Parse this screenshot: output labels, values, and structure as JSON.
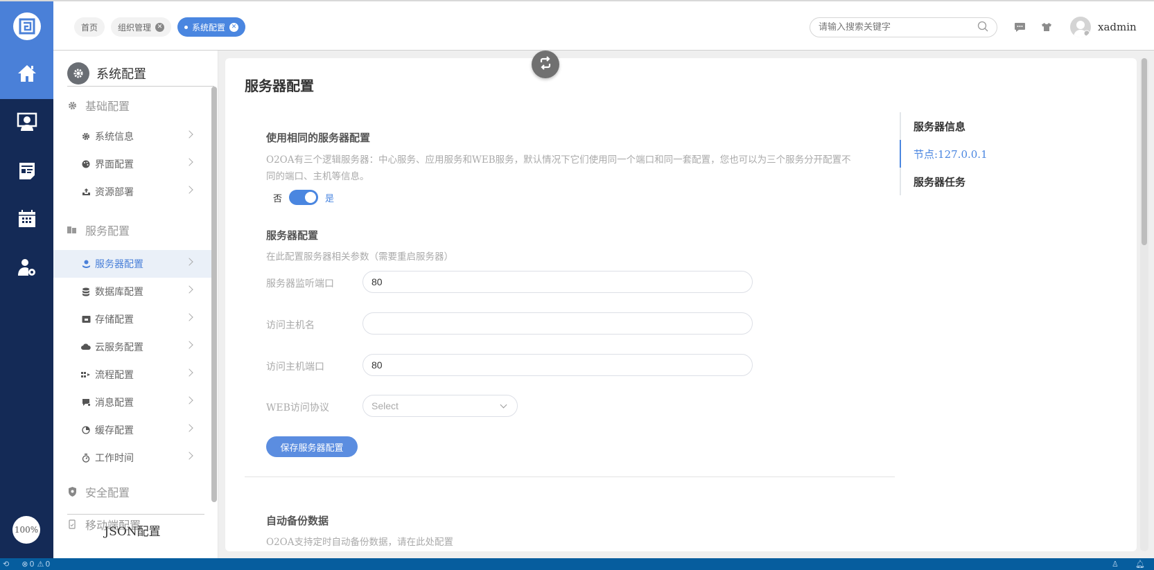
{
  "header": {
    "tabs": [
      {
        "label": "首页",
        "closable": false,
        "active": false
      },
      {
        "label": "组织管理",
        "closable": true,
        "active": false
      },
      {
        "label": "系统配置",
        "closable": true,
        "active": true
      }
    ],
    "search_placeholder": "请输入搜索关键字",
    "username": "xadmin"
  },
  "leftnav": {
    "items": [
      "home-icon",
      "desktop-user-icon",
      "news-icon",
      "calendar-icon",
      "user-settings-icon"
    ],
    "zoom": "100%"
  },
  "sidebar": {
    "title": "系统配置",
    "groups": [
      {
        "label": "基础配置",
        "items": [
          "系统信息",
          "界面配置",
          "资源部署"
        ]
      },
      {
        "label": "服务配置",
        "items": [
          "服务器配置",
          "数据库配置",
          "存储配置",
          "云服务配置",
          "流程配置",
          "消息配置",
          "缓存配置",
          "工作时间"
        ]
      },
      {
        "label": "安全配置",
        "items": []
      },
      {
        "label": "移动端配置",
        "items": []
      }
    ],
    "active_item": "服务器配置",
    "json_label": "JSON配置"
  },
  "main": {
    "title": "服务器配置",
    "same_config": {
      "title": "使用相同的服务器配置",
      "desc_line1": "O2OA有三个逻辑服务器：中心服务、应用服务和WEB服务，默认情况下它们使用同一个端口和同一套配置，您也可以为三个服务分开配置不",
      "desc_line2": "同的端口、主机等信息。",
      "toggle_off": "否",
      "toggle_on": "是",
      "toggle_value": true
    },
    "server_config": {
      "title": "服务器配置",
      "desc": "在此配置服务器相关参数（需要重启服务器）",
      "fields": [
        {
          "label": "服务器监听端口",
          "value": "80"
        },
        {
          "label": "访问主机名",
          "value": ""
        },
        {
          "label": "访问主机端口",
          "value": "80"
        }
      ],
      "protocol_label": "WEB访问协议",
      "protocol_placeholder": "Select",
      "save_label": "保存服务器配置"
    },
    "backup": {
      "title": "自动备份数据",
      "desc": "O2OA支持定时自动备份数据，请在此处配置"
    },
    "anchor": [
      {
        "label": "服务器信息",
        "active": false
      },
      {
        "label": "节点:127.0.0.1",
        "active": true
      },
      {
        "label": "服务器任务",
        "active": false
      }
    ]
  },
  "statusbar": {
    "errors": "0",
    "warnings": "0"
  },
  "colors": {
    "accent": "#4a86e0",
    "nav_bg": "#142a56",
    "status_bg": "#065d9e"
  }
}
